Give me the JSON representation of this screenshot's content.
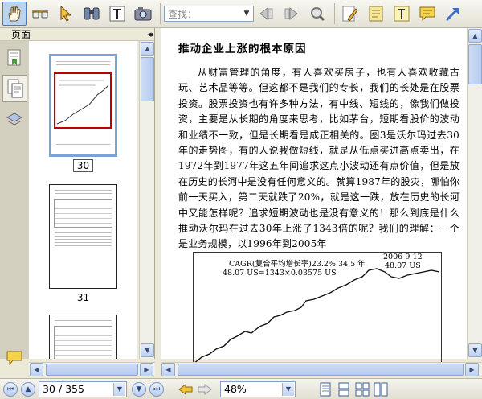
{
  "toolbar": {
    "tools": [
      "hand-tool",
      "select-text-tool",
      "arrow-select-tool",
      "find-tool",
      "text-tool",
      "snapshot-tool"
    ],
    "search_placeholder": "查找：",
    "annotate_tools": [
      "pencil-tool",
      "note-tool",
      "text-box-tool",
      "comment-tool",
      "arrow-tool"
    ]
  },
  "left_panel": {
    "title": "页面",
    "collapse_label": "◂◂",
    "tabs": [
      "bookmarks",
      "pages",
      "layers",
      "comments",
      "attachments"
    ],
    "thumbnails": [
      {
        "label": "30",
        "selected": true
      },
      {
        "label": "31",
        "selected": false
      },
      {
        "label": "",
        "selected": false
      }
    ]
  },
  "document": {
    "title": "推动企业上涨的根本原因",
    "paragraph": "从财富管理的角度，有人喜欢买房子，也有人喜欢收藏古玩、艺术品等等。但这都不是我们的专长，我们的长处是在股票投资。股票投资也有许多种方法，有中线、短线的，像我们做投资，主要是从长期的角度来思考，比如茅台，短期看股价的波动和业绩不一致，但是长期看是成正相关的。图3是沃尔玛过去30年的走势图，有的人说我做短线，就是从低点买进高点卖出，在1972年到1977年这五年间追求这点小波动还有点价值，但是放在历史的长河中是没有任何意义的。就算1987年的股灾，哪怕你前一天买入，第二天就跌了20%，就是这一跌，放在历史的长河中又能怎样呢？追求短期波动也是没有意义的！那么到底是什么推动沃尔玛在过去30年上涨了1343倍的呢？我们的理解：一个是业务规模，以1996年到2005年",
    "chart": {
      "cagr_text": "CAGR(复合平均增长率)23.2%  34.5 年",
      "calc_text": "48.07 US=1343×0.03575 US",
      "date_label": "2006-9-12",
      "price_label": "48.07 US"
    }
  },
  "statusbar": {
    "page_value": "30 / 355",
    "zoom_value": "48%"
  },
  "colors": {
    "chrome": "#ece9d8",
    "selection_blue": "#4b78b8",
    "thumb_highlight": "#c00000"
  }
}
